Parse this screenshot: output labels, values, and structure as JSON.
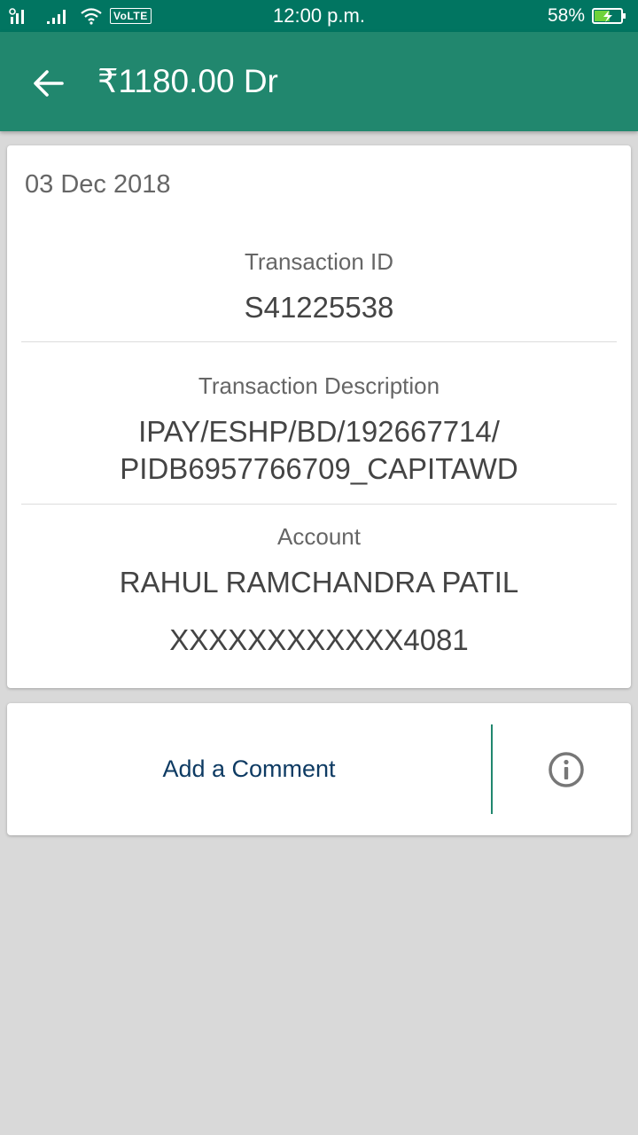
{
  "status_bar": {
    "time": "12:00 p.m.",
    "network_badge": "VoLTE",
    "battery_percent": "58%",
    "battery_level": 0.58,
    "icons": [
      "signal-icon",
      "signal-icon-2",
      "wifi-icon",
      "battery-charging-icon"
    ]
  },
  "app_bar": {
    "title": "₹1180.00 Dr",
    "back_icon": "back-arrow-icon"
  },
  "details": {
    "date": "03 Dec 2018",
    "transaction_id_label": "Transaction ID",
    "transaction_id": "S41225538",
    "description_label": "Transaction Description",
    "description_line1": "IPAY/ESHP/BD/192667714/",
    "description_line2": "PIDB6957766709_CAPITAWD",
    "account_label": "Account",
    "account_name": "RAHUL RAMCHANDRA PATIL",
    "account_number": "XXXXXXXXXXXX4081"
  },
  "comment": {
    "add_comment_label": "Add a Comment",
    "info_icon": "info-icon"
  },
  "colors": {
    "status_bar": "#017561",
    "app_bar": "#21876e",
    "background": "#d9d9d9",
    "comment_text": "#0e3b63"
  }
}
